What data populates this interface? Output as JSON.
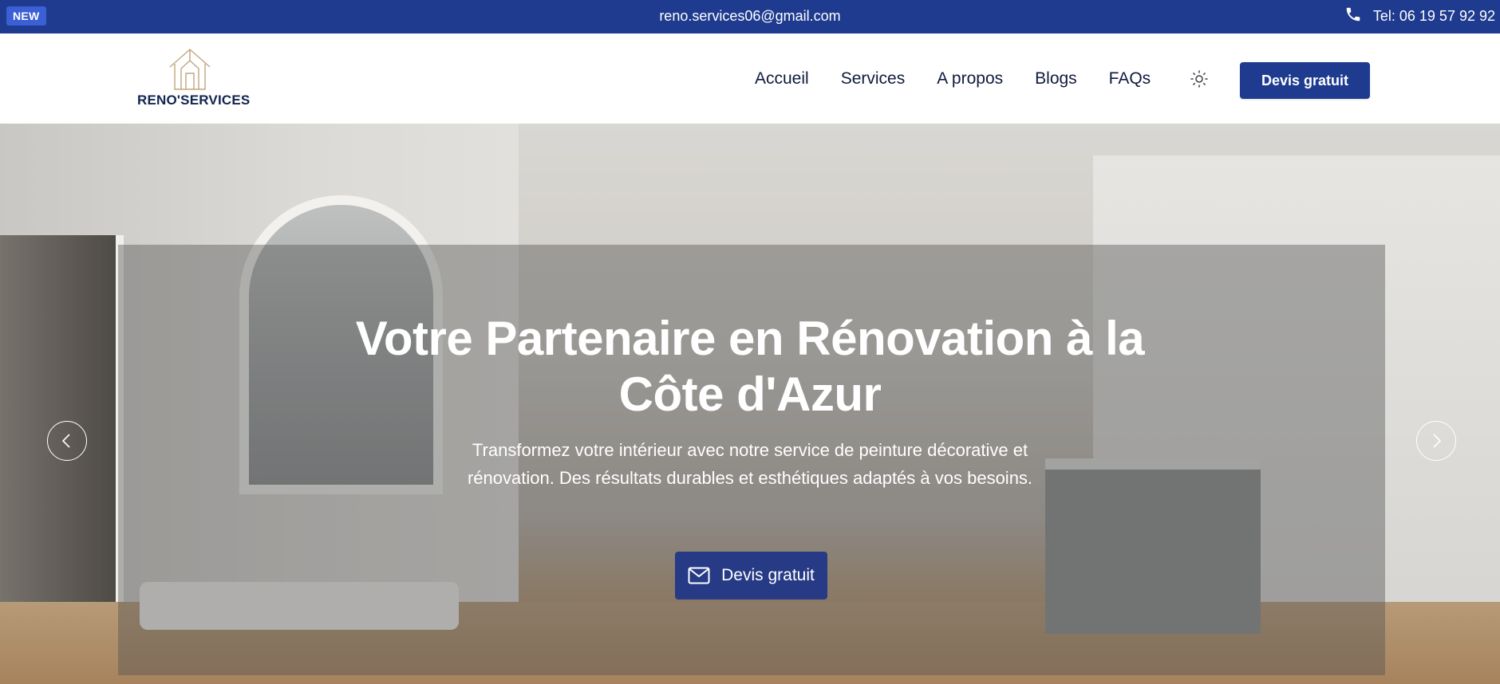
{
  "topbar": {
    "badge": "NEW",
    "email": "reno.services06@gmail.com",
    "phone": "Tel: 06 19 57 92 92"
  },
  "header": {
    "logo_text": "RENO'SERVICES",
    "nav": [
      {
        "label": "Accueil"
      },
      {
        "label": "Services"
      },
      {
        "label": "A propos"
      },
      {
        "label": "Blogs"
      },
      {
        "label": "FAQs"
      }
    ],
    "theme_icon": "sun-icon",
    "cta_label": "Devis gratuit"
  },
  "hero": {
    "title_line1": "Votre Partenaire en Rénovation à la",
    "title_line2": "Côte d'Azur",
    "subtitle": "Transformez votre intérieur avec notre service de peinture décorative et rénovation. Des résultats durables et esthétiques adaptés à vos besoins.",
    "cta_label": "Devis gratuit",
    "cta_icon": "mail-icon",
    "prev_icon": "chevron-left-icon",
    "next_icon": "chevron-right-icon"
  },
  "colors": {
    "brand": "#1f3b8f",
    "badge": "#3b5fd4",
    "hero_cta": "#263a86",
    "logo_gold": "#c2a57e"
  }
}
